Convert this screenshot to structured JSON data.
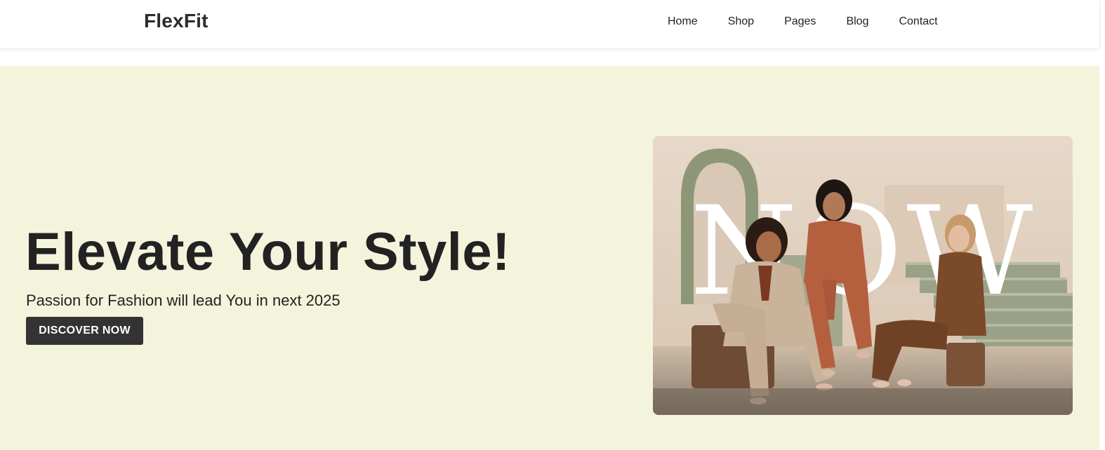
{
  "brand": {
    "name": "FlexFit"
  },
  "nav": {
    "items": [
      {
        "label": "Home"
      },
      {
        "label": "Shop"
      },
      {
        "label": "Pages"
      },
      {
        "label": "Blog"
      },
      {
        "label": "Contact"
      }
    ]
  },
  "hero": {
    "title": "Elevate Your Style!",
    "subtitle": "Passion for Fashion will lead You in next 2025",
    "cta_label": "DISCOVER NOW",
    "image": {
      "text_overlay": "NOW",
      "colors": {
        "backdrop": "#e3d2c2",
        "arch": "#8d9778",
        "stairs": "#9ba187",
        "floor": "#c9b7a2",
        "suit_beige": "#c9b39a",
        "suit_rust": "#b4603f",
        "suit_brown": "#7a4a2a"
      }
    },
    "background": "#f4f4dc"
  }
}
